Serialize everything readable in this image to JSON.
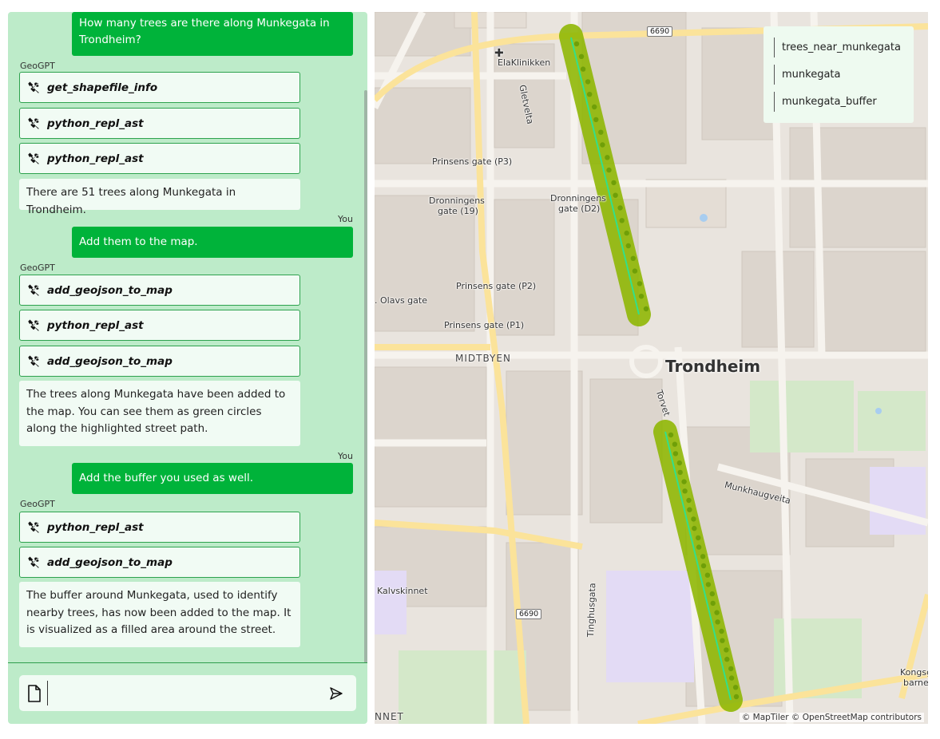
{
  "chat": {
    "messages": [
      {
        "role": "user",
        "text": "How many trees are there along Munkegata in Trondheim?"
      },
      {
        "role": "bot_label",
        "text": "GeoGPT"
      },
      {
        "role": "tool",
        "name": "get_shapefile_info"
      },
      {
        "role": "tool",
        "name": "python_repl_ast"
      },
      {
        "role": "tool",
        "name": "python_repl_ast"
      },
      {
        "role": "bot",
        "text": "There are 51 trees along Munkegata in Trondheim."
      },
      {
        "role": "user_label",
        "text": "You"
      },
      {
        "role": "user",
        "text": "Add them to the map."
      },
      {
        "role": "bot_label",
        "text": "GeoGPT"
      },
      {
        "role": "tool",
        "name": "add_geojson_to_map"
      },
      {
        "role": "tool",
        "name": "python_repl_ast"
      },
      {
        "role": "tool",
        "name": "add_geojson_to_map"
      },
      {
        "role": "bot",
        "text": "The trees along Munkegata have been added to the map. You can see them as green circles along the highlighted street path."
      },
      {
        "role": "user_label",
        "text": "You"
      },
      {
        "role": "user",
        "text": "Add the buffer you used as well."
      },
      {
        "role": "bot_label",
        "text": "GeoGPT"
      },
      {
        "role": "tool",
        "name": "python_repl_ast"
      },
      {
        "role": "tool",
        "name": "add_geojson_to_map"
      },
      {
        "role": "bot",
        "text": "The buffer around Munkegata, used to identify nearby trees, has now been added to the map. It is visualized as a filled area around the street."
      }
    ],
    "input": {
      "value": "",
      "placeholder": ""
    }
  },
  "map": {
    "legend": [
      "trees_near_munkegata",
      "munkegata",
      "munkegata_buffer"
    ],
    "city": "Trondheim",
    "district": "MIDTBYEN",
    "labels": {
      "elaklinikken": "ElaKlinikken",
      "gletvelta": "Gletvelta",
      "prinsens_p3": "Prinsens gate (P3)",
      "dronningens_19_a": "Dronningens",
      "dronningens_19_b": "gate (19)",
      "dronningens_d2_a": "Dronningens",
      "dronningens_d2_b": "gate (D2)",
      "prinsens_p2": "Prinsens gate (P2)",
      "olavs": ". Olavs gate",
      "prinsens_p1": "Prinsens gate (P1)",
      "torvet": "Torvet",
      "munkhaugveita": "Munkhaugveita",
      "kalvskinnet": "Kalvskinnet",
      "tinghusgata": "Tinghusgata",
      "kongsg_a": "Kongsg",
      "kongsg_b": "barnel",
      "nnet": "NNET"
    },
    "road_number": "6690",
    "attribution": "© MapTiler © OpenStreetMap contributors",
    "colors": {
      "buffer": "#8db600",
      "line": "#33e08a",
      "tree": "#76a80a",
      "road_major": "#fbe39a"
    }
  }
}
